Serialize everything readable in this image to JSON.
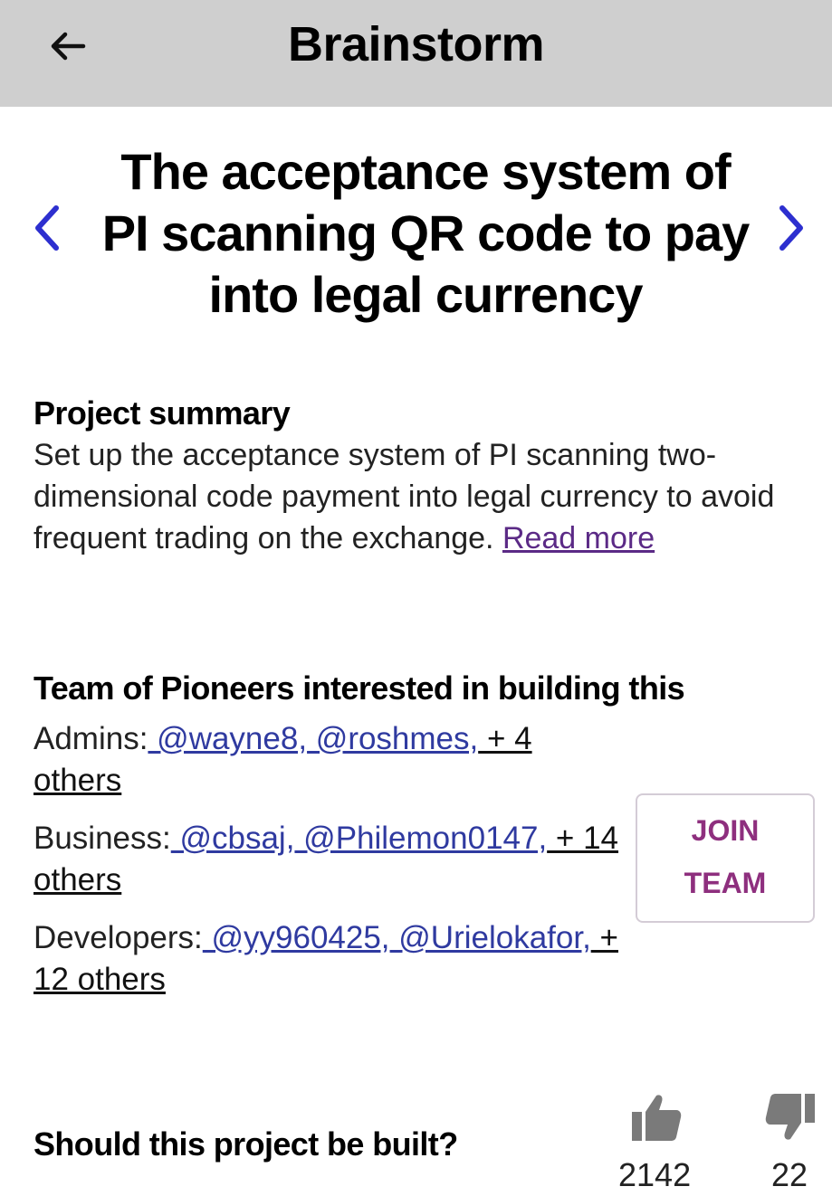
{
  "appbar": {
    "title": "Brainstorm"
  },
  "project": {
    "title": "The acceptance system of PI scanning QR code to pay into legal currency"
  },
  "summary": {
    "heading": "Project summary",
    "text": "Set up the acceptance system of PI scanning two-dimensional code payment into legal currency to avoid frequent trading on the exchange. ",
    "read_more": "Read more"
  },
  "team": {
    "heading": "Team of Pioneers interested in building this",
    "admins": {
      "label": "Admins:",
      "m1": " @wayne8,",
      "m2": " @roshmes,",
      "others": " + 4 others"
    },
    "business": {
      "label": "Business:",
      "m1": " @cbsaj,",
      "m2": " @Philemon0147,",
      "others": " + 14 others"
    },
    "developers": {
      "label": "Developers:",
      "m1": " @yy960425,",
      "m2": " @Urielokafor,",
      "others": " + 12 others"
    },
    "join_line1": "JOIN",
    "join_line2": "TEAM"
  },
  "vote": {
    "question": "Should this project be built?",
    "up_count": "2142",
    "down_count": "22"
  },
  "colors": {
    "appbar_bg": "#cfcfcf",
    "nav_arrow": "#2d2fcf",
    "mention": "#2f3aa0",
    "read_more": "#5b2a86",
    "join_text": "#8e2f7e",
    "thumb_gray": "#7a7a7a"
  },
  "icons": {
    "back": "arrow-left-icon",
    "prev": "chevron-left-icon",
    "next": "chevron-right-icon",
    "upvote": "thumbs-up-icon",
    "downvote": "thumbs-down-icon"
  }
}
